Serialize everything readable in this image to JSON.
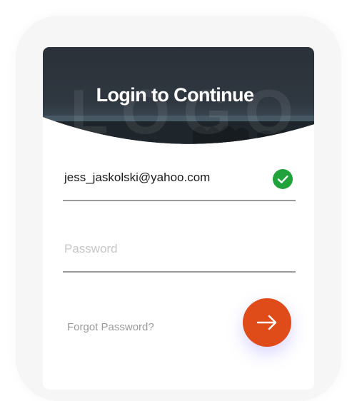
{
  "login": {
    "title": "Login to Continue",
    "watermark": "LOGO",
    "email": {
      "value": "jess_jaskolski@yahoo.com",
      "status_icon": "check-circle-icon"
    },
    "password": {
      "placeholder": "Password"
    },
    "forgot_label": "Forgot Password?",
    "submit_icon": "arrow-right-icon"
  },
  "colors": {
    "accent": "#e04b1a",
    "success": "#1fa33a",
    "header_dark": "#2a3038",
    "placeholder": "#c6c6c6",
    "underline": "#9a9a9a"
  }
}
